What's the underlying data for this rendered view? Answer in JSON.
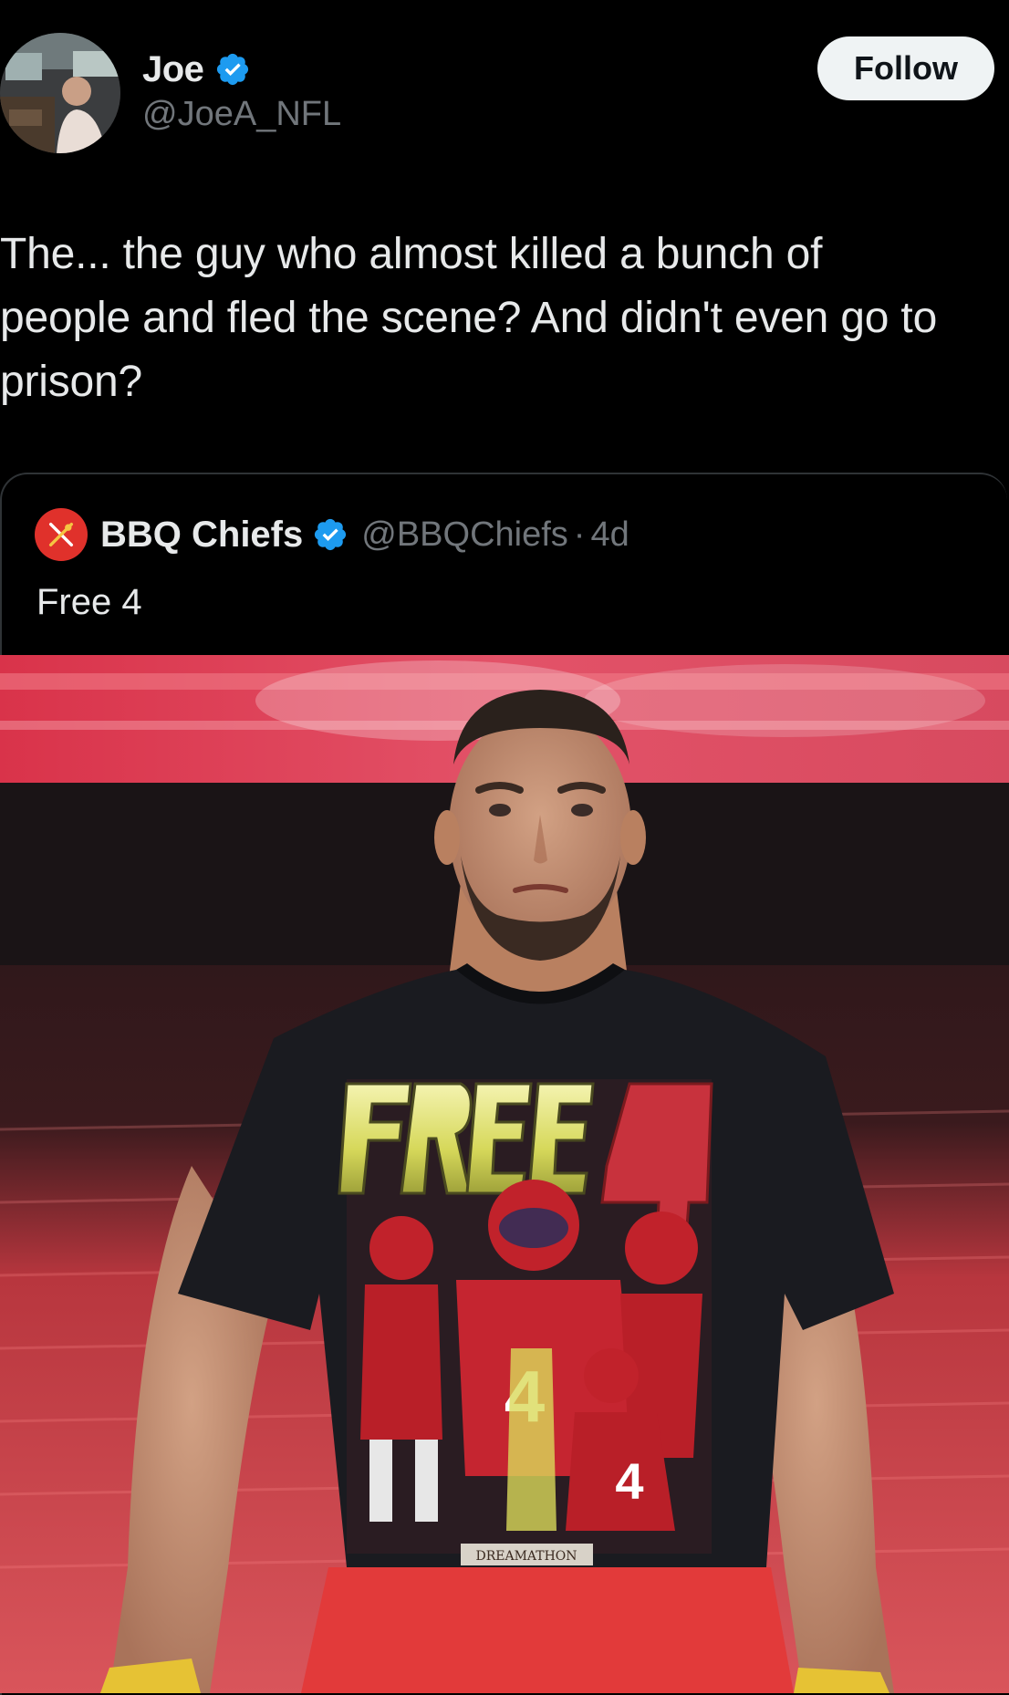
{
  "author": {
    "display_name": "Joe",
    "handle": "@JoeA_NFL",
    "verified": true
  },
  "follow_button": {
    "label": "Follow"
  },
  "tweet": {
    "text": "The... the guy who almost killed a bunch of\npeople and fled the scene? And didn't even go to\nprison?"
  },
  "quoted_tweet": {
    "display_name": "BBQ Chiefs",
    "handle": "@BBQChiefs",
    "separator": "·",
    "time": "4d",
    "text": "Free 4",
    "media": {
      "shirt_text": "FREE4",
      "shirt_tag": "DREAMATHON"
    }
  },
  "icons": {
    "verified": "verified-badge-icon",
    "quote_avatar": "crossed-utensils-icon"
  },
  "colors": {
    "background": "#000000",
    "text_primary": "#e7e9ea",
    "text_secondary": "#71767b",
    "verified_blue": "#1d9bf0",
    "follow_bg": "#eff3f4",
    "border": "#2f3336",
    "chiefs_red": "#e0312b"
  }
}
